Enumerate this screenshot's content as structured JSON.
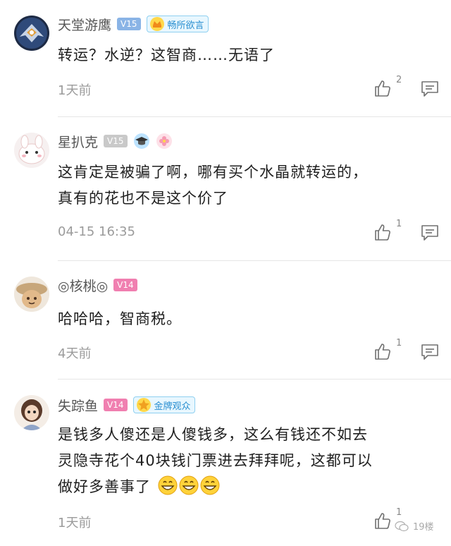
{
  "comments": [
    {
      "username": "天堂游鹰",
      "vip": "V15",
      "medal": "畅所欲言",
      "content": [
        "转运？水逆？这智商……无语了"
      ],
      "time": "1天前",
      "likes": "2"
    },
    {
      "username": "星扒克",
      "vip": "V15",
      "content": [
        "这肯定是被骗了啊，哪有买个水晶就转运的，",
        "真有的花也不是这个价了"
      ],
      "time": "04-15 16:35",
      "likes": "1"
    },
    {
      "username": "◎核桃◎",
      "vip": "V14",
      "content": [
        "哈哈哈，智商税。"
      ],
      "time": "4天前",
      "likes": "1"
    },
    {
      "username": "失踪鱼",
      "vip": "V14",
      "medal": "金牌观众",
      "content": [
        "是钱多人傻还是人傻钱多，这么有钱还不如去",
        "灵隐寺花个40块钱门票进去拜拜呢，这都可以",
        "做好多善事了"
      ],
      "time": "1天前",
      "likes": "1"
    }
  ],
  "watermark": "19楼",
  "icons": {
    "like": "thumbs-up-icon",
    "reply": "comment-icon",
    "emoji": "grin-emoji-icon",
    "watermark": "wechat-icon"
  },
  "colors": {
    "vip_blue": "#8ab4e6",
    "vip_gray": "#c9c9c9",
    "vip_pink": "#f07fb0",
    "medal_border": "#8fd0f0",
    "meta_gray": "#9b9b9b"
  }
}
